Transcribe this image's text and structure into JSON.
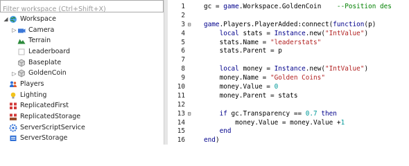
{
  "explorer": {
    "filter_placeholder": "Filter workspace (Ctrl+Shift+X)",
    "items": [
      {
        "label": "Workspace",
        "icon": "globe-icon",
        "expand": "collapse",
        "depth": 0
      },
      {
        "label": "Camera",
        "icon": "camera-icon",
        "expand": "expand",
        "depth": 1
      },
      {
        "label": "Terrain",
        "icon": "terrain-icon",
        "expand": "",
        "depth": 1
      },
      {
        "label": "Leaderboard",
        "icon": "part-icon",
        "expand": "",
        "depth": 1
      },
      {
        "label": "Baseplate",
        "icon": "cube-icon",
        "expand": "",
        "depth": 1
      },
      {
        "label": "GoldenCoin",
        "icon": "cube-icon",
        "expand": "expand",
        "depth": 1
      },
      {
        "label": "Players",
        "icon": "players-icon",
        "expand": "",
        "depth": 0
      },
      {
        "label": "Lighting",
        "icon": "lightbulb-icon",
        "expand": "",
        "depth": 0
      },
      {
        "label": "ReplicatedFirst",
        "icon": "replicated-first-icon",
        "expand": "",
        "depth": 0
      },
      {
        "label": "ReplicatedStorage",
        "icon": "replicated-storage-icon",
        "expand": "",
        "depth": 0
      },
      {
        "label": "ServerScriptService",
        "icon": "server-script-service-icon",
        "expand": "",
        "depth": 0
      },
      {
        "label": "ServerStorage",
        "icon": "server-storage-icon",
        "expand": "",
        "depth": 0
      }
    ]
  },
  "editor": {
    "lines": [
      {
        "n": "1",
        "fold": "",
        "tokens": [
          [
            "plain",
            "gc = "
          ],
          [
            "kw",
            "game"
          ],
          [
            "plain",
            ".Workspace.GoldenCoin    "
          ],
          [
            "com",
            "--Position des"
          ]
        ]
      },
      {
        "n": "2",
        "fold": "",
        "tokens": []
      },
      {
        "n": "3",
        "fold": "minus",
        "tokens": [
          [
            "kw",
            "game"
          ],
          [
            "plain",
            ".Players.PlayerAdded:connect("
          ],
          [
            "kw",
            "function"
          ],
          [
            "plain",
            "(p)"
          ]
        ]
      },
      {
        "n": "4",
        "fold": "",
        "tokens": [
          [
            "plain",
            "    "
          ],
          [
            "kw",
            "local"
          ],
          [
            "plain",
            " stats = "
          ],
          [
            "kw",
            "Instance"
          ],
          [
            "plain",
            ".new("
          ],
          [
            "str",
            "\"IntValue\""
          ],
          [
            "plain",
            ")"
          ]
        ]
      },
      {
        "n": "5",
        "fold": "",
        "tokens": [
          [
            "plain",
            "    stats.Name = "
          ],
          [
            "str",
            "\"leaderstats\""
          ]
        ]
      },
      {
        "n": "6",
        "fold": "",
        "tokens": [
          [
            "plain",
            "    stats.Parent = p"
          ]
        ]
      },
      {
        "n": "7",
        "fold": "",
        "tokens": []
      },
      {
        "n": "8",
        "fold": "",
        "tokens": [
          [
            "plain",
            "    "
          ],
          [
            "kw",
            "local"
          ],
          [
            "plain",
            " money = "
          ],
          [
            "kw",
            "Instance"
          ],
          [
            "plain",
            ".new("
          ],
          [
            "str",
            "\"IntValue\""
          ],
          [
            "plain",
            ")"
          ]
        ]
      },
      {
        "n": "9",
        "fold": "",
        "tokens": [
          [
            "plain",
            "    money.Name = "
          ],
          [
            "str",
            "\"Golden Coins\""
          ]
        ]
      },
      {
        "n": "10",
        "fold": "",
        "tokens": [
          [
            "plain",
            "    money.Value = "
          ],
          [
            "num",
            "0"
          ]
        ]
      },
      {
        "n": "11",
        "fold": "",
        "tokens": [
          [
            "plain",
            "    money.Parent = stats"
          ]
        ]
      },
      {
        "n": "12",
        "fold": "",
        "tokens": []
      },
      {
        "n": "13",
        "fold": "minus",
        "tokens": [
          [
            "plain",
            "    "
          ],
          [
            "kw",
            "if"
          ],
          [
            "plain",
            " gc.Transparency == "
          ],
          [
            "num",
            "0.7"
          ],
          [
            "plain",
            " "
          ],
          [
            "kw",
            "then"
          ]
        ]
      },
      {
        "n": "14",
        "fold": "",
        "tokens": [
          [
            "plain",
            "        money.Value = money.Value +"
          ],
          [
            "num",
            "1"
          ]
        ]
      },
      {
        "n": "15",
        "fold": "",
        "tokens": [
          [
            "plain",
            "    "
          ],
          [
            "kw",
            "end"
          ]
        ]
      },
      {
        "n": "16",
        "fold": "",
        "tokens": [
          [
            "kw",
            "end"
          ],
          [
            "plain",
            ")"
          ]
        ]
      }
    ]
  }
}
